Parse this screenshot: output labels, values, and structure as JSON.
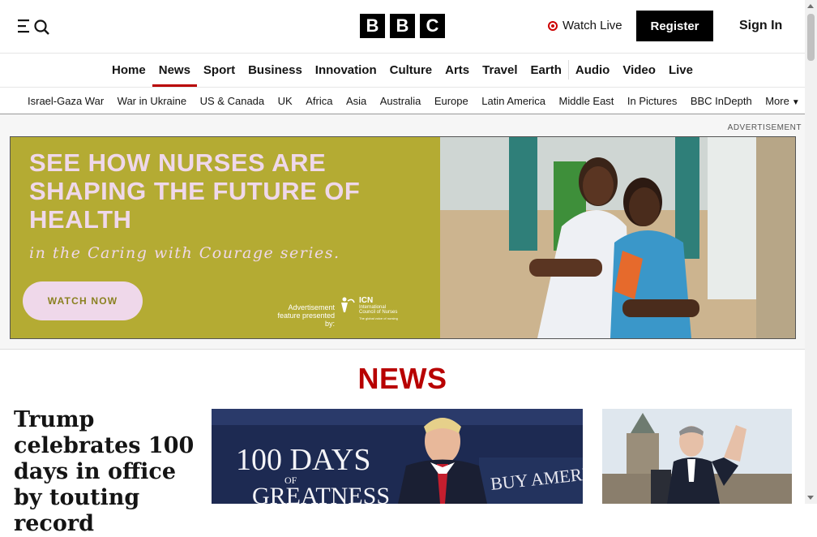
{
  "header": {
    "logo_letters": [
      "B",
      "B",
      "C"
    ],
    "watch_live": "Watch Live",
    "register": "Register",
    "sign_in": "Sign In"
  },
  "main_nav": [
    "Home",
    "News",
    "Sport",
    "Business",
    "Innovation",
    "Culture",
    "Arts",
    "Travel",
    "Earth",
    "Audio",
    "Video",
    "Live"
  ],
  "main_nav_active": "News",
  "sub_nav": [
    "Israel-Gaza War",
    "War in Ukraine",
    "US & Canada",
    "UK",
    "Africa",
    "Asia",
    "Australia",
    "Europe",
    "Latin America",
    "Middle East",
    "In Pictures",
    "BBC InDepth"
  ],
  "sub_nav_more": "More",
  "ad": {
    "label": "ADVERTISEMENT",
    "headline": "SEE HOW NURSES ARE SHAPING THE FUTURE OF HEALTH",
    "script": "in the Caring with Courage series.",
    "button": "WATCH NOW",
    "presented": "Advertisement feature presented by:",
    "sponsor_abbrev": "ICN",
    "sponsor_name": "International Council of Nurses",
    "sponsor_tagline": "The global voice of nursing"
  },
  "section_title": "NEWS",
  "lead_story": {
    "headline": "Trump celebrates 100 days in office by touting record",
    "image_sign_line1": "100 DAYS",
    "image_sign_line2": "OF",
    "image_sign_line3": "GREATNESS",
    "image_banner": "BUY AMERICA"
  },
  "colors": {
    "brand_red": "#b80000",
    "ad_olive": "#b4ab33",
    "ad_pink": "#efd8ea"
  },
  "icons": [
    "menu-icon",
    "search-icon",
    "live-dot-icon",
    "chevron-down-icon",
    "icn-logo-icon"
  ]
}
